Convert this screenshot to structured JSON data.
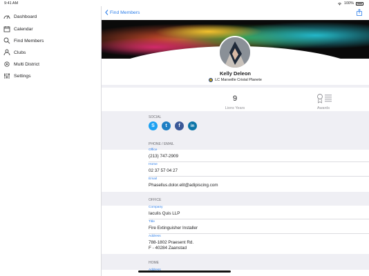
{
  "status": {
    "time": "9:41 AM",
    "battery": "100%"
  },
  "sidebar": {
    "items": [
      {
        "label": "Dashboard",
        "icon": "dashboard-icon"
      },
      {
        "label": "Calendar",
        "icon": "calendar-icon"
      },
      {
        "label": "Find Members",
        "icon": "find-members-icon"
      },
      {
        "label": "Clubs",
        "icon": "clubs-icon"
      },
      {
        "label": "Multi District",
        "icon": "multi-district-icon"
      },
      {
        "label": "Settings",
        "icon": "settings-icon"
      }
    ]
  },
  "navbar": {
    "back_label": "Find Members",
    "share_icon": "share-icon"
  },
  "profile": {
    "name": "Kelly Deleon",
    "club": "LC Marseille Cristal Planete",
    "lions_years_value": "9",
    "lions_years_label": "Lions Years",
    "awards_label": "Awards"
  },
  "social": {
    "header": "SOCIAL",
    "icons": [
      "skype-icon",
      "twitter-icon",
      "facebook-icon",
      "linkedin-icon"
    ]
  },
  "phone_email": {
    "header": "PHONE / EMAIL",
    "office_label": "Office",
    "office_value": "(213) 747-2909",
    "home_label": "Home",
    "home_value": "02 37 57 04 27",
    "email_label": "Email",
    "email_value": "Phasellus.dolor.elit@adipiscing.com"
  },
  "office": {
    "header": "OFFICE",
    "company_label": "Company",
    "company_value": "Iaculis Quis LLP",
    "title_label": "Title",
    "title_value": "Fire Extinguisher Installer",
    "address_label": "Address",
    "address_line1": "788-1802 Praesent Rd.",
    "address_line2": "F - 40284 Zaanstad"
  },
  "home": {
    "header": "HOME",
    "address_label": "Address"
  },
  "colors": {
    "accent": "#2b7de9",
    "skype": "#1da1f2",
    "twitter": "#1d7fc4",
    "facebook": "#3b5998",
    "linkedin": "#0e76a8"
  }
}
